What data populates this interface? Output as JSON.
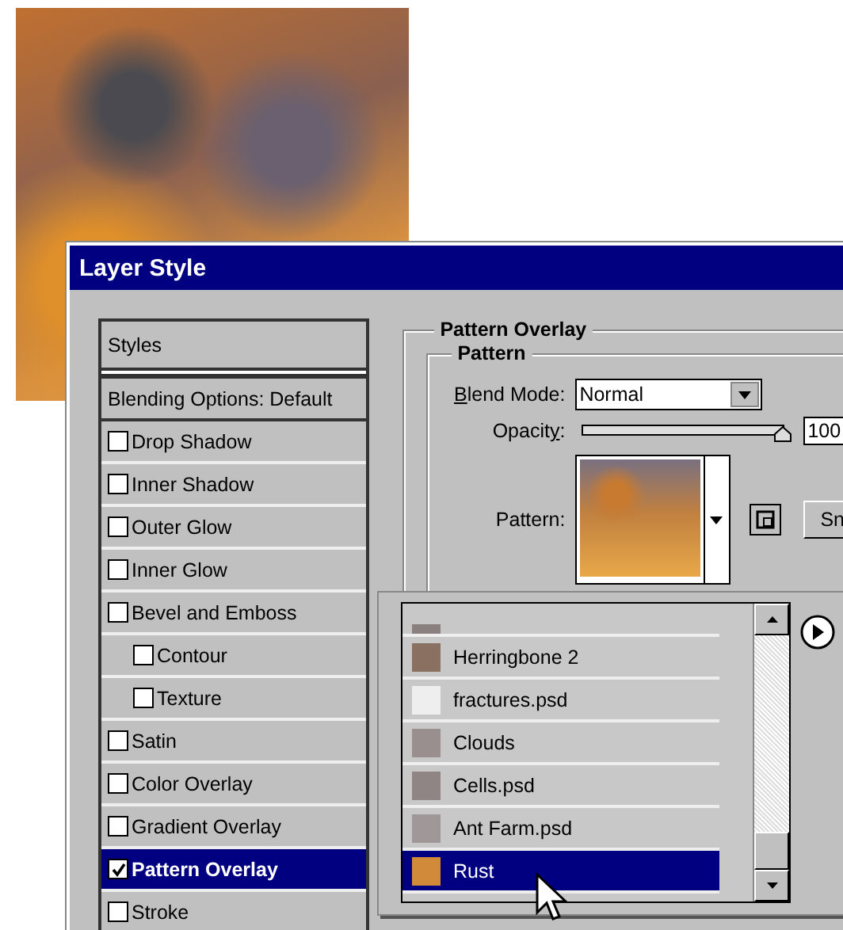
{
  "dialog": {
    "title": "Layer Style"
  },
  "styles_panel": {
    "header": "Styles",
    "blending_options": "Blending Options: Default",
    "items": [
      {
        "label": "Drop Shadow",
        "checked": false,
        "selected": false
      },
      {
        "label": "Inner Shadow",
        "checked": false,
        "selected": false
      },
      {
        "label": "Outer Glow",
        "checked": false,
        "selected": false
      },
      {
        "label": "Inner Glow",
        "checked": false,
        "selected": false
      },
      {
        "label": "Bevel and Emboss",
        "checked": false,
        "selected": false,
        "children": [
          {
            "label": "Contour",
            "checked": false,
            "selected": false
          },
          {
            "label": "Texture",
            "checked": false,
            "selected": false
          }
        ]
      },
      {
        "label": "Satin",
        "checked": false,
        "selected": false
      },
      {
        "label": "Color Overlay",
        "checked": false,
        "selected": false
      },
      {
        "label": "Gradient Overlay",
        "checked": false,
        "selected": false
      },
      {
        "label": "Pattern Overlay",
        "checked": true,
        "selected": true
      },
      {
        "label": "Stroke",
        "checked": false,
        "selected": false
      }
    ]
  },
  "pattern_overlay": {
    "title": "Pattern Overlay",
    "group": "Pattern",
    "blend_mode": {
      "mnemonic": "B",
      "label_after": "lend Mode:",
      "value": "Normal"
    },
    "opacity": {
      "label_before": "Opacit",
      "mnemonic": "y",
      "label_after": ":",
      "level": 1,
      "value": "100"
    },
    "pattern": {
      "label": "Pattern:"
    },
    "snap_button": "Sn"
  },
  "pattern_picker": {
    "items": [
      {
        "name": "Herringbone 2",
        "color": "#8a7060",
        "selected": false
      },
      {
        "name": "fractures.psd",
        "color": "#eeeeee",
        "selected": false
      },
      {
        "name": "Clouds",
        "color": "#9a8f8f",
        "selected": false
      },
      {
        "name": "Cells.psd",
        "color": "#8f8585",
        "selected": false
      },
      {
        "name": "Ant Farm.psd",
        "color": "#a09898",
        "selected": false
      },
      {
        "name": "Rust",
        "color": "#d08a3a",
        "selected": true
      }
    ]
  }
}
